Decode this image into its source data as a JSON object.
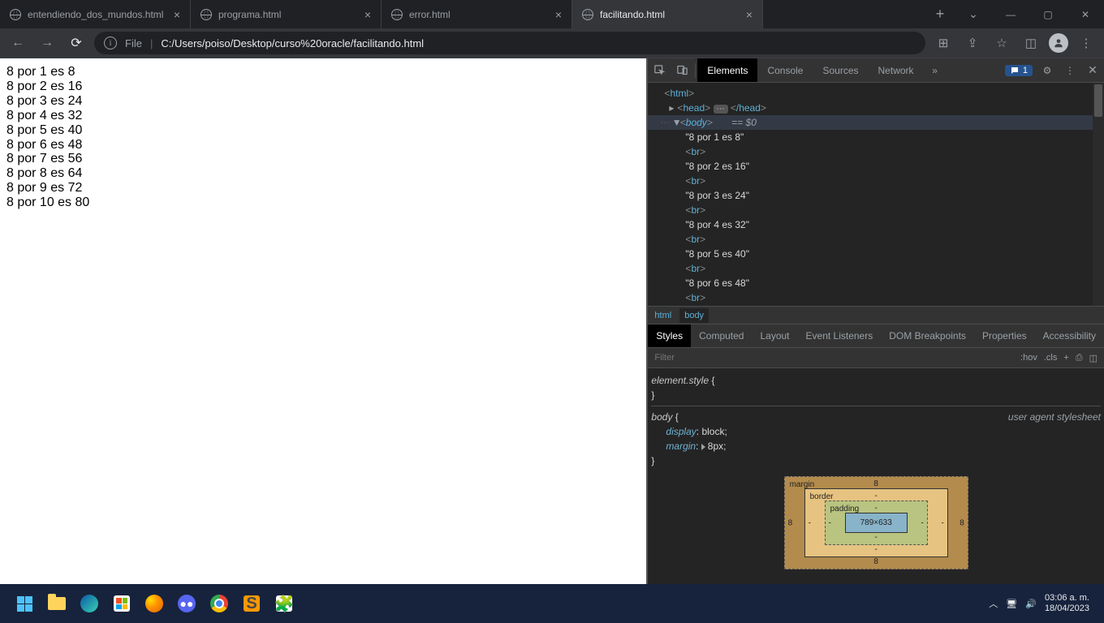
{
  "tabs": [
    {
      "title": "entendiendo_dos_mundos.html",
      "active": false
    },
    {
      "title": "programa.html",
      "active": false
    },
    {
      "title": "error.html",
      "active": false
    },
    {
      "title": "facilitando.html",
      "active": true
    }
  ],
  "address": {
    "file_label": "File",
    "path": "C:/Users/poiso/Desktop/curso%20oracle/facilitando.html"
  },
  "page_lines": [
    "8 por 1 es 8",
    "8 por 2 es 16",
    "8 por 3 es 24",
    "8 por 4 es 32",
    "8 por 5 es 40",
    "8 por 6 es 48",
    "8 por 7 es 56",
    "8 por 8 es 64",
    "8 por 9 es 72",
    "8 por 10 es 80"
  ],
  "devtools": {
    "tabs": [
      "Elements",
      "Console",
      "Sources",
      "Network"
    ],
    "active_tab": "Elements",
    "issues_count": "1",
    "dom_html_open": "html",
    "dom_head": "head",
    "dom_head_close": "/head",
    "dom_body": "body",
    "selected_hint": "== $0",
    "dom_text_lines": [
      "\"8 por 1 es 8\"",
      "\"8 por 2 es 16\"",
      "\"8 por 3 es 24\"",
      "\"8 por 4 es 32\"",
      "\"8 por 5 es 40\"",
      "\"8 por 6 es 48\"",
      "\"8 por 7 es 56\""
    ],
    "br_tag": "br",
    "crumbs": [
      "html",
      "body"
    ],
    "styles_tabs": [
      "Styles",
      "Computed",
      "Layout",
      "Event Listeners",
      "DOM Breakpoints",
      "Properties",
      "Accessibility"
    ],
    "styles_active": "Styles",
    "filter_placeholder": "Filter",
    "hov": ":hov",
    "cls": ".cls",
    "element_style": "element.style",
    "body_selector": "body",
    "ua_sheet": "user agent stylesheet",
    "prop_display": "display",
    "val_display": "block",
    "prop_margin": "margin",
    "val_margin": "8px",
    "box_model": {
      "margin_label": "margin",
      "border_label": "border",
      "padding_label": "padding",
      "margin": "8",
      "border": "-",
      "padding": "-",
      "content": "789×633"
    }
  },
  "taskbar": {
    "time": "03:06 a. m.",
    "date": "18/04/2023"
  }
}
